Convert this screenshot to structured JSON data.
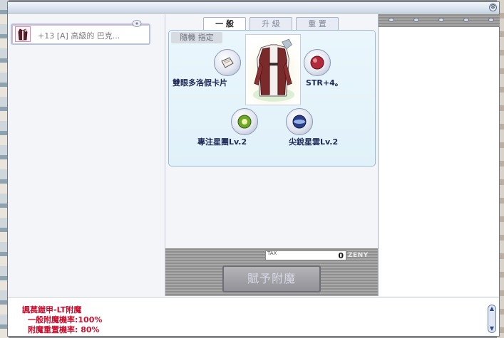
{
  "window": {
    "close_glyph": "⊗"
  },
  "item_list": {
    "items": [
      {
        "label": "+13 [A] 高級的 巴克...",
        "icon": "red-coat-icon"
      }
    ]
  },
  "tabs": [
    {
      "label": "一 般",
      "active": true
    },
    {
      "label": "升 級",
      "active": false
    },
    {
      "label": "重 置",
      "active": false
    }
  ],
  "enchant": {
    "mode_label": "隨機 指定",
    "equipment_icon": "red-white-coat-icon",
    "slots": [
      {
        "label": "雙眼多洛假卡片",
        "icon": "card-icon"
      },
      {
        "label": "STR+4。",
        "icon": "red-orb-icon"
      },
      {
        "label": "專注星團Lv.2",
        "icon": "green-star-icon"
      },
      {
        "label": "尖銳星雲Lv.2",
        "icon": "blue-nebula-icon"
      }
    ]
  },
  "tax": {
    "label": "TAX",
    "value": "0",
    "currency": "ZENY"
  },
  "enchant_button": {
    "label": "賦予附魔"
  },
  "description": {
    "title": "諷萇鎧甲-LT附魔",
    "lines": [
      "一般附魔機率:100%",
      "附魔重置機率: 80%"
    ]
  },
  "colors": {
    "desc_text": "#c8102e",
    "slot_label": "#1e2a55",
    "window_border": "#6e7a8a"
  }
}
